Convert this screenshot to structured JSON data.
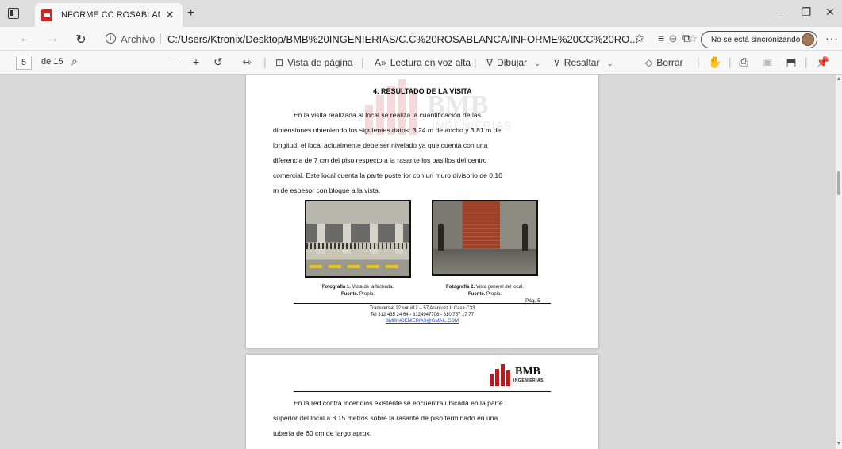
{
  "browser": {
    "tab_title": "INFORME CC ROSABLANCA ALE",
    "tab_close": "✕",
    "new_tab": "+",
    "site_label": "Archivo",
    "url": "C:/Users/Ktronix/Desktop/BMB%20INGENIERIAS/C.C%20ROSABLANCA/INFORME%20CC%20RO...",
    "sync_label": "No se está sincronizando"
  },
  "pdf_toolbar": {
    "page_current": "5",
    "page_total_label": "de 15",
    "page_view_label": "Vista de página",
    "read_aloud_label": "Lectura en voz alta",
    "draw_label": "Dibujar",
    "highlight_label": "Resaltar",
    "erase_label": "Borrar"
  },
  "page5": {
    "watermark_logo": "BMB",
    "watermark_sub": "INGENIERIAS",
    "heading": "4.  RESULTADO DE LA VISITA",
    "paragraph_lines": [
      "En la visita realizada al local se realiza la cuantificación de las",
      "dimensiones obteniendo los siguientes datos: 3,24 m de ancho y 3,81 m de",
      "longitud; el local actualmente debe ser nivelado ya que cuenta con una",
      "diferencia de 7 cm del piso respecto a la rasante los pasillos del centro",
      "comercial. Este local cuenta la parte posterior con un muro divisorio de 0,10",
      "m de espesor con bloque a la vista."
    ],
    "photo1": {
      "caption_title": "Fotografía 1.",
      "caption_text": " Vista de la fachada.",
      "source_label": "Fuente.",
      "source_text": " Propia."
    },
    "photo2": {
      "caption_title": "Fotografía 2.",
      "caption_text": " Vista general del local.",
      "source_label": "Fuente.",
      "source_text": " Propia."
    },
    "page_number": "Pág. 5",
    "footer_address": "Transversal 22 sur #12 – 57 Aranjuez II Casa C33",
    "footer_phones": "Tel 312 435 24 64 - 3124947706 - 310 757 17 77",
    "footer_email": "BMBINGENIERIAS@GMAIL.COM"
  },
  "page6": {
    "logo_text": "BMB",
    "logo_sub": "INGENIERÍAS",
    "paragraph_lines": [
      "En la red contra incendios existente se encuentra ubicada en la parte",
      "superior del local a 3.15 metros sobre la rasante de piso terminado en una",
      "tubería de 60 cm de largo aprox."
    ]
  },
  "colors": {
    "brand_red": "#b71c1c",
    "link_blue": "#1a3ec7"
  }
}
